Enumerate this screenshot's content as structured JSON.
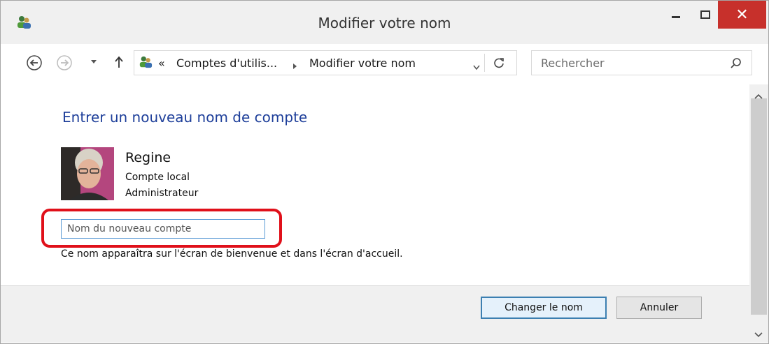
{
  "window": {
    "title": "Modifier votre nom",
    "close_symbol": "✕",
    "icons": [
      "users-icon",
      "minimize-icon",
      "maximize-icon",
      "close-icon"
    ]
  },
  "address_bar": {
    "back_icon": "back-arrow-icon",
    "forward_icon": "forward-arrow-icon",
    "recent_icon": "chevron-down-icon",
    "up_icon": "up-arrow-icon",
    "breadcrumbs": {
      "overflow": "«",
      "crumb1": "Comptes d'utilis...",
      "crumb2": "Modifier votre nom"
    },
    "refresh_icon": "refresh-icon",
    "search": {
      "placeholder": "Rechercher"
    }
  },
  "main": {
    "heading": "Entrer un nouveau nom de compte",
    "user": {
      "name": "Regine",
      "type": "Compte local",
      "role": "Administrateur"
    },
    "new_name_input": {
      "placeholder": "Nom du nouveau compte",
      "value": ""
    },
    "hint": "Ce nom apparaîtra sur l'écran de bienvenue et dans l'écran d'accueil."
  },
  "footer": {
    "change_label": "Changer le nom",
    "cancel_label": "Annuler"
  },
  "colors": {
    "heading": "#1e3f9a",
    "close_button": "#c7302b",
    "highlight": "#e0101a",
    "input_border": "#5b9bd5",
    "primary_border": "#3c7fb1"
  }
}
